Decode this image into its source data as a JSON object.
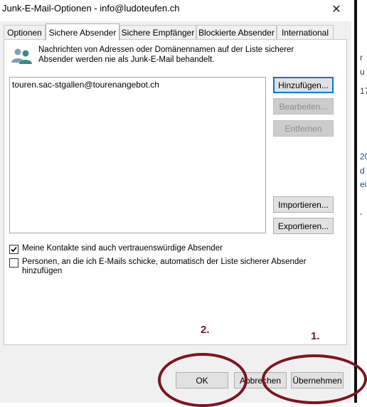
{
  "window": {
    "title": "Junk-E-Mail-Optionen - info@ludoteufen.ch",
    "close_symbol": "✕"
  },
  "tabs": [
    {
      "label": "Optionen",
      "active": false
    },
    {
      "label": "Sichere Absender",
      "active": true
    },
    {
      "label": "Sichere Empfänger",
      "active": false
    },
    {
      "label": "Blockierte Absender",
      "active": false
    },
    {
      "label": "International",
      "active": false
    }
  ],
  "info": {
    "icon": "contacts-icon",
    "text": "Nachrichten von Adressen oder Domänennamen auf der Liste sicherer Absender werden nie als Junk-E-Mail behandelt."
  },
  "safe_senders": {
    "items": [
      "touren.sac-stgallen@tourenangebot.ch"
    ]
  },
  "buttons": {
    "add": "Hinzufügen...",
    "edit": "Bearbeiten...",
    "remove": "Entfernen",
    "import": "Importieren...",
    "export": "Exportieren...",
    "ok": "OK",
    "cancel": "Abbrechen",
    "apply": "Übernehmen"
  },
  "checkboxes": [
    {
      "label": "Meine Kontakte sind auch vertrauenswürdige Absender",
      "checked": true
    },
    {
      "label": "Personen, an die ich E-Mails schicke, automatisch der Liste sicherer Absender hinzufügen",
      "checked": false
    }
  ],
  "annotations": {
    "step1": "1.",
    "step2": "2."
  },
  "background_fragments": [
    {
      "text": "r",
      "color": "black"
    },
    {
      "text": "u",
      "color": "black"
    },
    {
      "text": "17",
      "color": "black"
    },
    {
      "text": "20",
      "color": "blue"
    },
    {
      "text": "d",
      "color": "blue"
    },
    {
      "text": "ei",
      "color": "blue"
    },
    {
      "text": ",",
      "color": "blue"
    }
  ],
  "colors": {
    "annotation": "#7b1520",
    "accent": "#0078d7",
    "background_link": "#1f4e9e"
  }
}
